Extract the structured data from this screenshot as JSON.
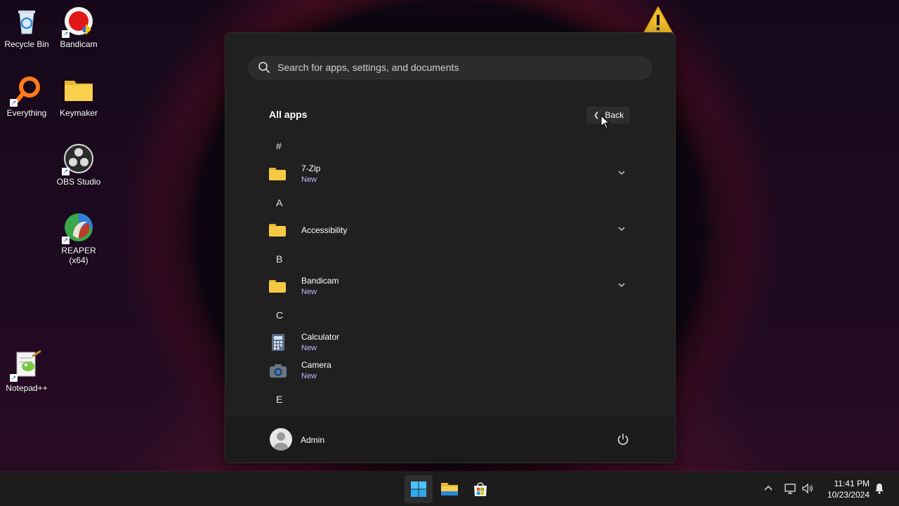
{
  "desktop": {
    "icons": [
      {
        "label": "Recycle Bin"
      },
      {
        "label": "Bandicam"
      },
      {
        "label": "Everything"
      },
      {
        "label": "Keymaker"
      },
      {
        "label": "OBS Studio"
      },
      {
        "label": "REAPER (x64)"
      },
      {
        "label": "Notepad++"
      }
    ]
  },
  "start_menu": {
    "search_placeholder": "Search for apps, settings, and documents",
    "all_apps_title": "All apps",
    "back_label": "Back",
    "sections": [
      {
        "letter": "#",
        "apps": [
          {
            "name": "7-Zip",
            "sub": "New",
            "icon": "folder-icon",
            "expandable": true
          }
        ]
      },
      {
        "letter": "A",
        "apps": [
          {
            "name": "Accessibility",
            "sub": "",
            "icon": "folder-icon",
            "expandable": true
          }
        ]
      },
      {
        "letter": "B",
        "apps": [
          {
            "name": "Bandicam",
            "sub": "New",
            "icon": "folder-icon",
            "expandable": true
          }
        ]
      },
      {
        "letter": "C",
        "apps": [
          {
            "name": "Calculator",
            "sub": "New",
            "icon": "calculator-icon",
            "expandable": false
          },
          {
            "name": "Camera",
            "sub": "New",
            "icon": "camera-icon",
            "expandable": false
          }
        ]
      },
      {
        "letter": "E",
        "apps": []
      }
    ],
    "user": {
      "name": "Admin"
    }
  },
  "taskbar": {
    "clock": {
      "time": "11:41 PM",
      "date": "10/23/2024"
    }
  },
  "colors": {
    "accent": "#c9b5ff",
    "folder": "#f6c945",
    "menu_bg": "#202020"
  }
}
